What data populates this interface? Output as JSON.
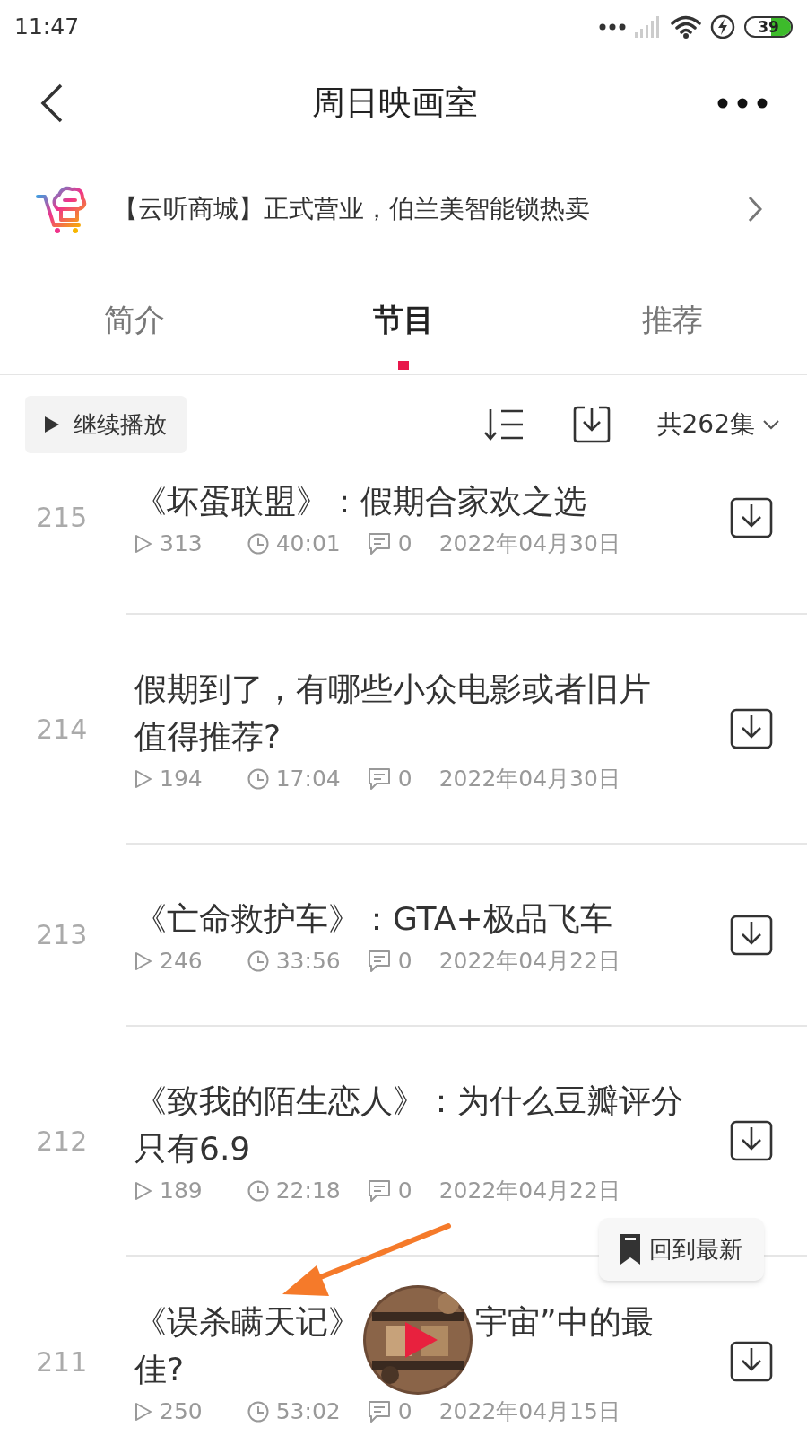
{
  "status_bar": {
    "time": "11:47",
    "battery": "39"
  },
  "header": {
    "title": "周日映画室"
  },
  "banner": {
    "text": "【云听商城】正式营业，伯兰美智能锁热卖"
  },
  "tabs": [
    {
      "label": "简介",
      "selected": false
    },
    {
      "label": "节目",
      "selected": true
    },
    {
      "label": "推荐",
      "selected": false
    }
  ],
  "toolbar": {
    "continue_button": "继续播放",
    "episode_count": "共262集"
  },
  "episodes": [
    {
      "number": "215",
      "title_lines": [
        "《坏蛋联盟》：假期合家欢之选"
      ],
      "plays": "313",
      "duration": "40:01",
      "comments": "0",
      "date": "2022年04月30日"
    },
    {
      "number": "214",
      "title_lines": [
        "假期到了，有哪些小众电影或者旧片",
        "值得推荐?"
      ],
      "plays": "194",
      "duration": "17:04",
      "comments": "0",
      "date": "2022年04月30日"
    },
    {
      "number": "213",
      "title_lines": [
        "《亡命救护车》：GTA+极品飞车"
      ],
      "plays": "246",
      "duration": "33:56",
      "comments": "0",
      "date": "2022年04月22日"
    },
    {
      "number": "212",
      "title_lines": [
        "《致我的陌生恋人》：为什么豆瓣评分",
        "只有6.9"
      ],
      "plays": "189",
      "duration": "22:18",
      "comments": "0",
      "date": "2022年04月22日"
    },
    {
      "number": "211",
      "title_lines": [
        [
          "《误杀瞒天记》",
          "宇宙”中的最"
        ],
        "佳?"
      ],
      "plays": "250",
      "duration": "53:02",
      "comments": "0",
      "date": "2022年04月15日"
    }
  ],
  "back_to_latest": "回到最新"
}
